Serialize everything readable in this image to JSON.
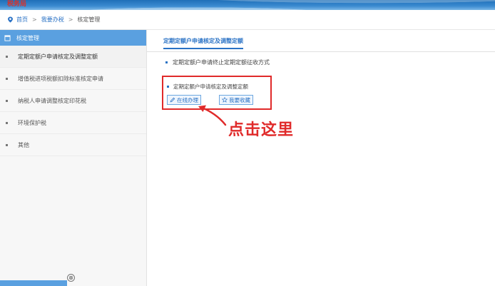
{
  "banner": {
    "logo_text": "税务局"
  },
  "breadcrumb": {
    "home": "首页",
    "sep1": ">",
    "level2": "我要办税",
    "sep2": ">",
    "current": "核定管理"
  },
  "sidebar": {
    "header": "核定管理",
    "items": [
      {
        "label": "定期定额户申请核定及调整定额"
      },
      {
        "label": "增值税进项税额扣除标准核定申请"
      },
      {
        "label": "纳税人申请调整核定印花税"
      },
      {
        "label": "环境保护税"
      },
      {
        "label": "其他"
      }
    ],
    "close_glyph": "⊗"
  },
  "main": {
    "tab_label": "定期定额户申请核定及调整定额",
    "item1": "定期定额户申请终止定期定额征收方式",
    "item2": "定期定额户申请核定及调整定额",
    "online_button": "在线办理",
    "collect_button": "我要收藏"
  },
  "annotation": {
    "text": "点击这里",
    "color": "#e02a2a"
  },
  "colors": {
    "accent": "#2a72c5",
    "sidebar_header": "#5aa0e0",
    "highlight": "#e02a2a"
  }
}
